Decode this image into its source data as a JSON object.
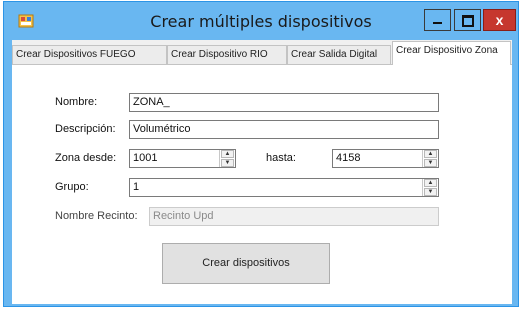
{
  "window": {
    "title": "Crear múltiples dispositivos",
    "close_label": "x"
  },
  "tabs": [
    {
      "label": "Crear Dispositivos FUEGO"
    },
    {
      "label": "Crear Dispositivo RIO"
    },
    {
      "label": "Crear Salida Digital"
    },
    {
      "label": "Crear Dispositivo Zona"
    }
  ],
  "form": {
    "nombre_label": "Nombre:",
    "nombre_value": "ZONA_",
    "descripcion_label": "Descripción:",
    "descripcion_value": "Volumétrico",
    "zona_desde_label": "Zona desde:",
    "zona_desde_value": "1001",
    "hasta_label": "hasta:",
    "hasta_value": "4158",
    "grupo_label": "Grupo:",
    "grupo_value": "1",
    "recinto_label": "Nombre Recinto:",
    "recinto_value": "Recinto Upd"
  },
  "actions": {
    "create_label": "Crear dispositivos"
  },
  "colors": {
    "titlebar": "#69b7f1",
    "close": "#c6372e"
  }
}
